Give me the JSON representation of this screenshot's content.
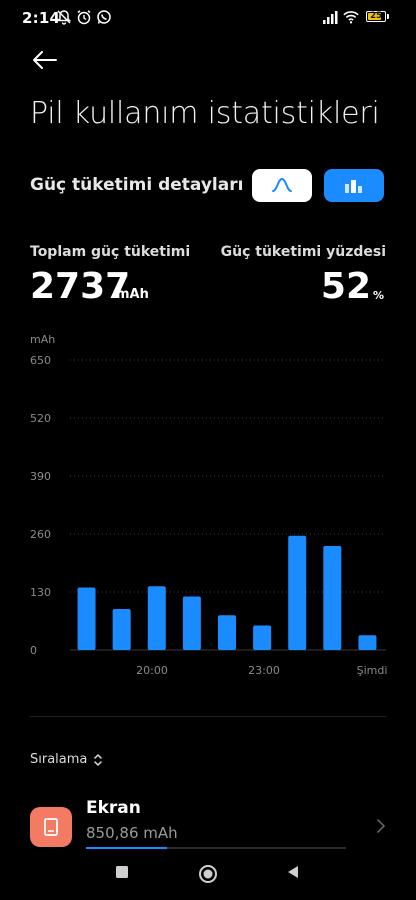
{
  "status_bar": {
    "time": "2:14",
    "battery": "25"
  },
  "header": {
    "title": "Pil kullanım istatistikleri"
  },
  "section": {
    "title": "Güç tüketimi detayları"
  },
  "summary": {
    "total_label": "Toplam güç tüketimi",
    "total_value": "2737",
    "total_unit": "mAh",
    "percent_label": "Güç tüketimi yüzdesi",
    "percent_value": "52",
    "percent_unit": "%"
  },
  "chart_data": {
    "type": "bar",
    "ylabel": "mAh",
    "yticks": [
      "650",
      "520",
      "390",
      "260",
      "130",
      "0"
    ],
    "ylim": [
      0,
      650
    ],
    "xticks": [
      "20:00",
      "23:00",
      "Şimdi"
    ],
    "values": [
      140,
      92,
      143,
      120,
      78,
      55,
      256,
      233,
      33
    ],
    "bar_color": "#1a8cff",
    "grid": true
  },
  "sort": {
    "label": "Sıralama"
  },
  "app_item": {
    "name": "Ekran",
    "value": "850,86 mAh",
    "icon_color": "#f37b63",
    "usage_fraction": 0.31
  },
  "colors": {
    "accent": "#1a8cff",
    "background": "#000000"
  },
  "icons": [
    "back-arrow-icon",
    "line-chart-icon",
    "bar-chart-icon",
    "sort-icon",
    "screen-icon",
    "chevron-right-icon"
  ]
}
